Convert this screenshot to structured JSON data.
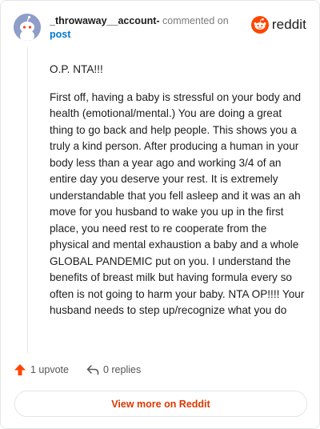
{
  "header": {
    "username": "_throwaway__account-",
    "action_text": "commented on",
    "post_link": "post"
  },
  "brand": {
    "logo_text": "reddit",
    "accent": "#ff4500"
  },
  "comment": {
    "paragraphs": [
      "O.P. NTA!!!",
      "First off, having a baby is stressful on your body and health (emotional/mental.) You are doing a great thing to go back and help people. This shows you a truly a kind person. After producing a human in your body less than a year ago and working 3/4 of an entire day you deserve your rest. It is extremely understandable that you fell asleep and it was an ah move for you husband to wake you up in the first place, you need rest to re cooperate from the physical and mental exhaustion a baby and a whole GLOBAL PANDEMIC put on you. I understand the benefits of breast milk but having formula every so often is not going to harm your baby. NTA OP!!!! Your husband needs to step up/recognize what you do"
    ]
  },
  "actions": {
    "upvote_label": "1 upvote",
    "replies_label": "0 replies",
    "upvote_icon": "upvote-arrow-icon",
    "reply_icon": "reply-arrow-icon"
  },
  "footer": {
    "view_more_label": "View more on Reddit"
  }
}
